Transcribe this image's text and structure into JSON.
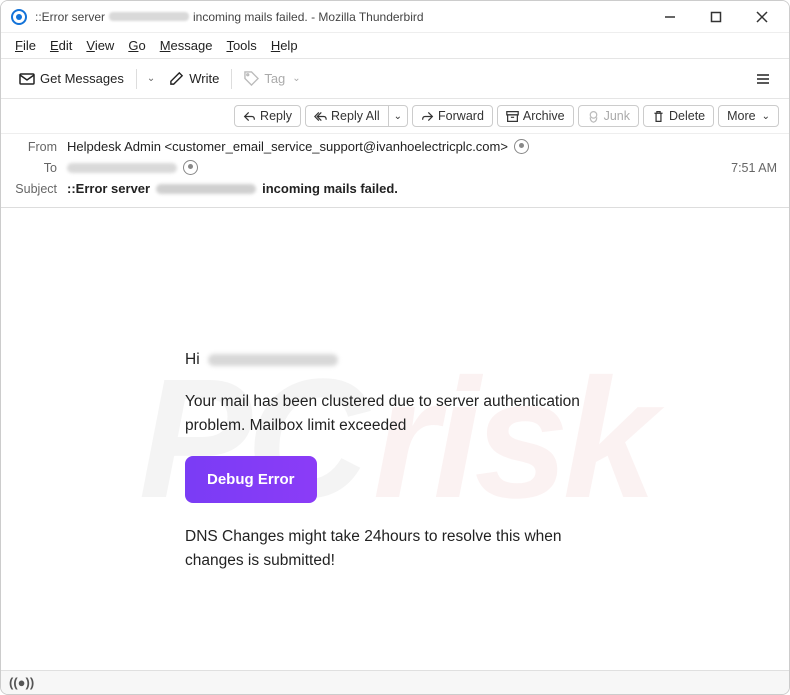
{
  "window": {
    "title_prefix": "::Error server",
    "title_suffix": "incoming mails failed. - Mozilla Thunderbird"
  },
  "menu": {
    "file": "File",
    "edit": "Edit",
    "view": "View",
    "go": "Go",
    "message": "Message",
    "tools": "Tools",
    "help": "Help"
  },
  "toolbar": {
    "get_messages": "Get Messages",
    "write": "Write",
    "tag": "Tag"
  },
  "actions": {
    "reply": "Reply",
    "reply_all": "Reply All",
    "forward": "Forward",
    "archive": "Archive",
    "junk": "Junk",
    "delete": "Delete",
    "more": "More"
  },
  "headers": {
    "from_label": "From",
    "from_value": "Helpdesk Admin <customer_email_service_support@ivanhoelectricplc.com>",
    "to_label": "To",
    "subject_label": "Subject",
    "subject_prefix": "::Error server",
    "subject_suffix": "incoming mails failed.",
    "time": "7:51 AM"
  },
  "email": {
    "greeting": "Hi",
    "body1": "Your mail has been clustered due to server authentication problem. Mailbox limit exceeded",
    "cta": "Debug Error",
    "body2": "DNS Changes might take 24hours to resolve this when changes is submitted!"
  }
}
